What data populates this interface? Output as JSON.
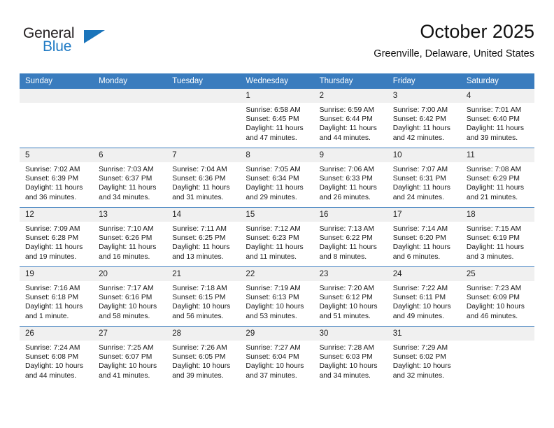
{
  "brand": {
    "name_top": "General",
    "name_bottom": "Blue",
    "accent_color": "#1b75bb",
    "dark_color": "#231f20"
  },
  "header": {
    "month_title": "October 2025",
    "location": "Greenville, Delaware, United States"
  },
  "theme": {
    "header_row_bg": "#3a7cbe",
    "daynum_bg": "#f0f0f0",
    "page_bg": "#ffffff"
  },
  "weekday_headers": [
    "Sunday",
    "Monday",
    "Tuesday",
    "Wednesday",
    "Thursday",
    "Friday",
    "Saturday"
  ],
  "weeks": [
    [
      {
        "day": "",
        "sunrise": "",
        "sunset": "",
        "daylight_line1": "",
        "daylight_line2": ""
      },
      {
        "day": "",
        "sunrise": "",
        "sunset": "",
        "daylight_line1": "",
        "daylight_line2": ""
      },
      {
        "day": "",
        "sunrise": "",
        "sunset": "",
        "daylight_line1": "",
        "daylight_line2": ""
      },
      {
        "day": "1",
        "sunrise": "Sunrise: 6:58 AM",
        "sunset": "Sunset: 6:45 PM",
        "daylight_line1": "Daylight: 11 hours",
        "daylight_line2": "and 47 minutes."
      },
      {
        "day": "2",
        "sunrise": "Sunrise: 6:59 AM",
        "sunset": "Sunset: 6:44 PM",
        "daylight_line1": "Daylight: 11 hours",
        "daylight_line2": "and 44 minutes."
      },
      {
        "day": "3",
        "sunrise": "Sunrise: 7:00 AM",
        "sunset": "Sunset: 6:42 PM",
        "daylight_line1": "Daylight: 11 hours",
        "daylight_line2": "and 42 minutes."
      },
      {
        "day": "4",
        "sunrise": "Sunrise: 7:01 AM",
        "sunset": "Sunset: 6:40 PM",
        "daylight_line1": "Daylight: 11 hours",
        "daylight_line2": "and 39 minutes."
      }
    ],
    [
      {
        "day": "5",
        "sunrise": "Sunrise: 7:02 AM",
        "sunset": "Sunset: 6:39 PM",
        "daylight_line1": "Daylight: 11 hours",
        "daylight_line2": "and 36 minutes."
      },
      {
        "day": "6",
        "sunrise": "Sunrise: 7:03 AM",
        "sunset": "Sunset: 6:37 PM",
        "daylight_line1": "Daylight: 11 hours",
        "daylight_line2": "and 34 minutes."
      },
      {
        "day": "7",
        "sunrise": "Sunrise: 7:04 AM",
        "sunset": "Sunset: 6:36 PM",
        "daylight_line1": "Daylight: 11 hours",
        "daylight_line2": "and 31 minutes."
      },
      {
        "day": "8",
        "sunrise": "Sunrise: 7:05 AM",
        "sunset": "Sunset: 6:34 PM",
        "daylight_line1": "Daylight: 11 hours",
        "daylight_line2": "and 29 minutes."
      },
      {
        "day": "9",
        "sunrise": "Sunrise: 7:06 AM",
        "sunset": "Sunset: 6:33 PM",
        "daylight_line1": "Daylight: 11 hours",
        "daylight_line2": "and 26 minutes."
      },
      {
        "day": "10",
        "sunrise": "Sunrise: 7:07 AM",
        "sunset": "Sunset: 6:31 PM",
        "daylight_line1": "Daylight: 11 hours",
        "daylight_line2": "and 24 minutes."
      },
      {
        "day": "11",
        "sunrise": "Sunrise: 7:08 AM",
        "sunset": "Sunset: 6:29 PM",
        "daylight_line1": "Daylight: 11 hours",
        "daylight_line2": "and 21 minutes."
      }
    ],
    [
      {
        "day": "12",
        "sunrise": "Sunrise: 7:09 AM",
        "sunset": "Sunset: 6:28 PM",
        "daylight_line1": "Daylight: 11 hours",
        "daylight_line2": "and 19 minutes."
      },
      {
        "day": "13",
        "sunrise": "Sunrise: 7:10 AM",
        "sunset": "Sunset: 6:26 PM",
        "daylight_line1": "Daylight: 11 hours",
        "daylight_line2": "and 16 minutes."
      },
      {
        "day": "14",
        "sunrise": "Sunrise: 7:11 AM",
        "sunset": "Sunset: 6:25 PM",
        "daylight_line1": "Daylight: 11 hours",
        "daylight_line2": "and 13 minutes."
      },
      {
        "day": "15",
        "sunrise": "Sunrise: 7:12 AM",
        "sunset": "Sunset: 6:23 PM",
        "daylight_line1": "Daylight: 11 hours",
        "daylight_line2": "and 11 minutes."
      },
      {
        "day": "16",
        "sunrise": "Sunrise: 7:13 AM",
        "sunset": "Sunset: 6:22 PM",
        "daylight_line1": "Daylight: 11 hours",
        "daylight_line2": "and 8 minutes."
      },
      {
        "day": "17",
        "sunrise": "Sunrise: 7:14 AM",
        "sunset": "Sunset: 6:20 PM",
        "daylight_line1": "Daylight: 11 hours",
        "daylight_line2": "and 6 minutes."
      },
      {
        "day": "18",
        "sunrise": "Sunrise: 7:15 AM",
        "sunset": "Sunset: 6:19 PM",
        "daylight_line1": "Daylight: 11 hours",
        "daylight_line2": "and 3 minutes."
      }
    ],
    [
      {
        "day": "19",
        "sunrise": "Sunrise: 7:16 AM",
        "sunset": "Sunset: 6:18 PM",
        "daylight_line1": "Daylight: 11 hours",
        "daylight_line2": "and 1 minute."
      },
      {
        "day": "20",
        "sunrise": "Sunrise: 7:17 AM",
        "sunset": "Sunset: 6:16 PM",
        "daylight_line1": "Daylight: 10 hours",
        "daylight_line2": "and 58 minutes."
      },
      {
        "day": "21",
        "sunrise": "Sunrise: 7:18 AM",
        "sunset": "Sunset: 6:15 PM",
        "daylight_line1": "Daylight: 10 hours",
        "daylight_line2": "and 56 minutes."
      },
      {
        "day": "22",
        "sunrise": "Sunrise: 7:19 AM",
        "sunset": "Sunset: 6:13 PM",
        "daylight_line1": "Daylight: 10 hours",
        "daylight_line2": "and 53 minutes."
      },
      {
        "day": "23",
        "sunrise": "Sunrise: 7:20 AM",
        "sunset": "Sunset: 6:12 PM",
        "daylight_line1": "Daylight: 10 hours",
        "daylight_line2": "and 51 minutes."
      },
      {
        "day": "24",
        "sunrise": "Sunrise: 7:22 AM",
        "sunset": "Sunset: 6:11 PM",
        "daylight_line1": "Daylight: 10 hours",
        "daylight_line2": "and 49 minutes."
      },
      {
        "day": "25",
        "sunrise": "Sunrise: 7:23 AM",
        "sunset": "Sunset: 6:09 PM",
        "daylight_line1": "Daylight: 10 hours",
        "daylight_line2": "and 46 minutes."
      }
    ],
    [
      {
        "day": "26",
        "sunrise": "Sunrise: 7:24 AM",
        "sunset": "Sunset: 6:08 PM",
        "daylight_line1": "Daylight: 10 hours",
        "daylight_line2": "and 44 minutes."
      },
      {
        "day": "27",
        "sunrise": "Sunrise: 7:25 AM",
        "sunset": "Sunset: 6:07 PM",
        "daylight_line1": "Daylight: 10 hours",
        "daylight_line2": "and 41 minutes."
      },
      {
        "day": "28",
        "sunrise": "Sunrise: 7:26 AM",
        "sunset": "Sunset: 6:05 PM",
        "daylight_line1": "Daylight: 10 hours",
        "daylight_line2": "and 39 minutes."
      },
      {
        "day": "29",
        "sunrise": "Sunrise: 7:27 AM",
        "sunset": "Sunset: 6:04 PM",
        "daylight_line1": "Daylight: 10 hours",
        "daylight_line2": "and 37 minutes."
      },
      {
        "day": "30",
        "sunrise": "Sunrise: 7:28 AM",
        "sunset": "Sunset: 6:03 PM",
        "daylight_line1": "Daylight: 10 hours",
        "daylight_line2": "and 34 minutes."
      },
      {
        "day": "31",
        "sunrise": "Sunrise: 7:29 AM",
        "sunset": "Sunset: 6:02 PM",
        "daylight_line1": "Daylight: 10 hours",
        "daylight_line2": "and 32 minutes."
      },
      {
        "day": "",
        "sunrise": "",
        "sunset": "",
        "daylight_line1": "",
        "daylight_line2": ""
      }
    ]
  ]
}
